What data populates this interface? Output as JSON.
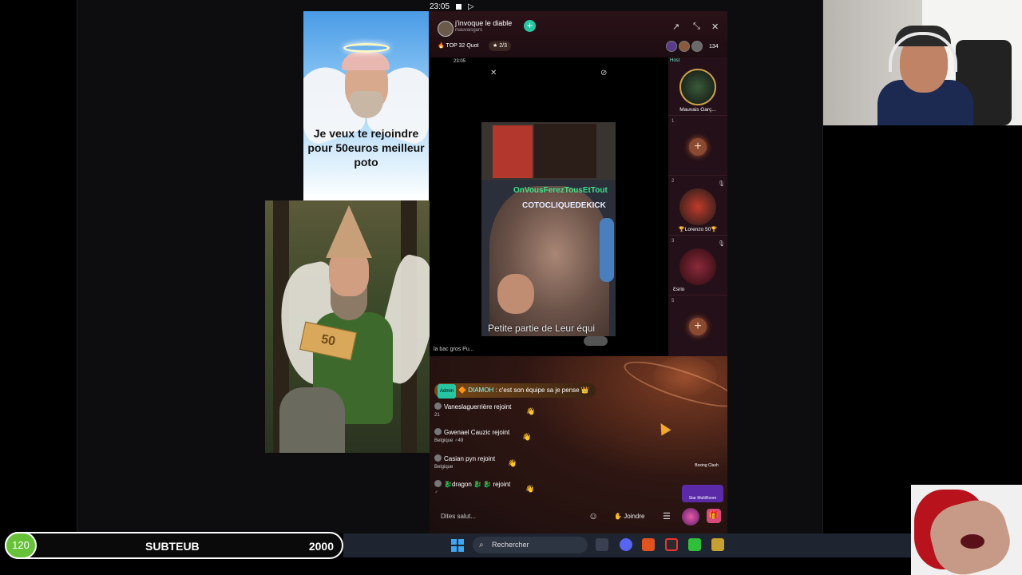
{
  "status_bar": {
    "time": "23:05"
  },
  "angel_meme": {
    "caption": "Je veux te rejoindre pour 50euros meilleur poto"
  },
  "elf_meme": {
    "banknote": "50"
  },
  "live": {
    "title": "j'invoque le diable",
    "subtitle": "mauvaisgars",
    "rank_label": "TOP 32 Quot",
    "badge_label": "2/3",
    "viewer_count": "134",
    "stream": {
      "mini_time": "23:05",
      "overlay_line1": "OnVousFerezTousEtTout",
      "overlay_line2": "COTOCLIQUEDEKICK",
      "subtitle": "Petite partie de Leur équi",
      "footer": "la bac gros Pu..."
    },
    "seats": [
      {
        "label": "Host",
        "name": "Mauvais Garç..."
      },
      {
        "label": "1",
        "name": ""
      },
      {
        "label": "2",
        "name": "🏆Lorenzo 50🏆"
      },
      {
        "label": "3",
        "name": "Ɛsrio"
      },
      {
        "label": "5",
        "name": ""
      }
    ],
    "chat": {
      "pinned_tag": "Admin",
      "pinned_user": "DIAMOH",
      "pinned_text": ": c'est son équipe sa je pense",
      "messages": [
        {
          "user": "Vaneslaguerrière",
          "action": "rejoint",
          "meta": "21"
        },
        {
          "user": "Gwenael Cauzic",
          "action": "rejoint",
          "meta": "Belgique  ♂49"
        },
        {
          "user": "Casian pyn",
          "action": "rejoint",
          "meta": "Belgique"
        },
        {
          "user": "🐉dragon 🐉 🐉",
          "action": "rejoint",
          "meta": "♂"
        }
      ]
    },
    "input_placeholder": "Dites salut...",
    "join_label": "Joindre",
    "promo1": "Boxing Clash",
    "promo2": "Star MultiRoom"
  },
  "subgoal": {
    "current": "120",
    "label": "SUBTEUB",
    "target": "2000"
  },
  "taskbar": {
    "search_label": "Rechercher"
  }
}
